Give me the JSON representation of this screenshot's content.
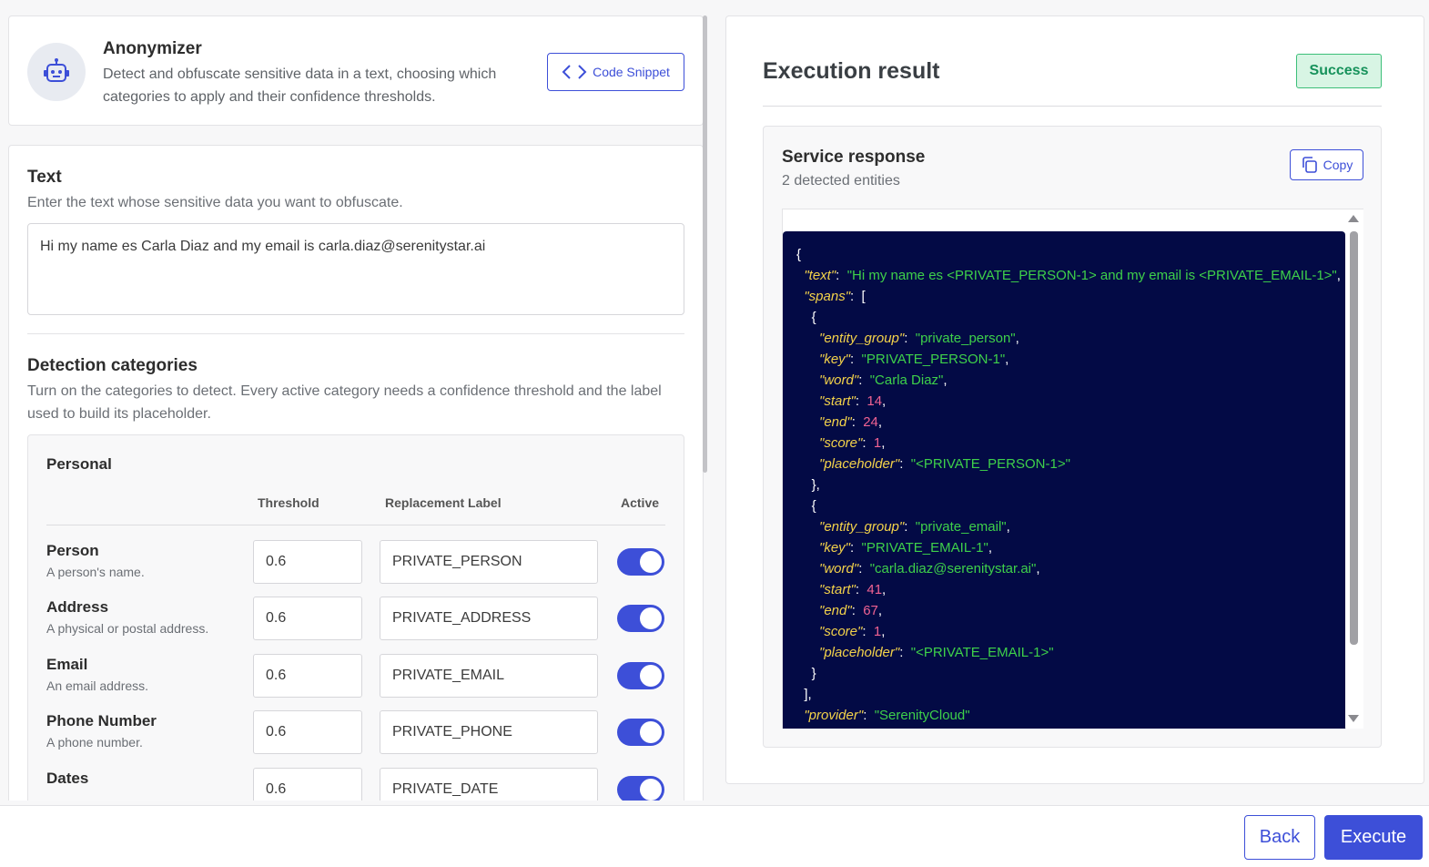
{
  "header": {
    "title": "Anonymizer",
    "description": "Detect and obfuscate sensitive data in a text, choosing which categories to apply and their confidence thresholds.",
    "code_snippet_label": "Code Snippet",
    "avatar_icon": "robot-icon"
  },
  "text_section": {
    "title": "Text",
    "description": "Enter the text whose sensitive data you want to obfuscate.",
    "value": "Hi my name es Carla Diaz and my email is carla.diaz@serenitystar.ai"
  },
  "detection": {
    "title": "Detection categories",
    "description": "Turn on the categories to detect. Every active category needs a confidence threshold and the label used to build its placeholder.",
    "group": "Personal",
    "columns": {
      "threshold": "Threshold",
      "label": "Replacement Label",
      "active": "Active"
    },
    "rows": [
      {
        "name": "Person",
        "desc": "A person's name.",
        "threshold": "0.6",
        "label": "PRIVATE_PERSON",
        "active": true
      },
      {
        "name": "Address",
        "desc": "A physical or postal address.",
        "threshold": "0.6",
        "label": "PRIVATE_ADDRESS",
        "active": true
      },
      {
        "name": "Email",
        "desc": "An email address.",
        "threshold": "0.6",
        "label": "PRIVATE_EMAIL",
        "active": true
      },
      {
        "name": "Phone Number",
        "desc": "A phone number.",
        "threshold": "0.6",
        "label": "PRIVATE_PHONE",
        "active": true
      },
      {
        "name": "Dates",
        "desc": "",
        "threshold": "0.6",
        "label": "PRIVATE_DATE",
        "active": true
      }
    ]
  },
  "result": {
    "title": "Execution result",
    "status": "Success",
    "response_title": "Service response",
    "response_subtitle": "2 detected entities",
    "copy_label": "Copy",
    "json_lines": [
      [
        [
          "p",
          "{"
        ]
      ],
      [
        [
          "p",
          "  "
        ],
        [
          "k",
          "\"text\""
        ],
        [
          "p",
          ":  "
        ],
        [
          "s",
          "\"Hi my name es <PRIVATE_PERSON-1> and my email is <PRIVATE_EMAIL-1>\""
        ],
        [
          "p",
          ","
        ]
      ],
      [
        [
          "p",
          "  "
        ],
        [
          "k",
          "\"spans\""
        ],
        [
          "p",
          ":  ["
        ]
      ],
      [
        [
          "p",
          "    {"
        ]
      ],
      [
        [
          "p",
          "      "
        ],
        [
          "k",
          "\"entity_group\""
        ],
        [
          "p",
          ":  "
        ],
        [
          "s",
          "\"private_person\""
        ],
        [
          "p",
          ","
        ]
      ],
      [
        [
          "p",
          "      "
        ],
        [
          "k",
          "\"key\""
        ],
        [
          "p",
          ":  "
        ],
        [
          "s",
          "\"PRIVATE_PERSON-1\""
        ],
        [
          "p",
          ","
        ]
      ],
      [
        [
          "p",
          "      "
        ],
        [
          "k",
          "\"word\""
        ],
        [
          "p",
          ":  "
        ],
        [
          "s",
          "\"Carla Diaz\""
        ],
        [
          "p",
          ","
        ]
      ],
      [
        [
          "p",
          "      "
        ],
        [
          "k",
          "\"start\""
        ],
        [
          "p",
          ":  "
        ],
        [
          "n",
          "14"
        ],
        [
          "p",
          ","
        ]
      ],
      [
        [
          "p",
          "      "
        ],
        [
          "k",
          "\"end\""
        ],
        [
          "p",
          ":  "
        ],
        [
          "n",
          "24"
        ],
        [
          "p",
          ","
        ]
      ],
      [
        [
          "p",
          "      "
        ],
        [
          "k",
          "\"score\""
        ],
        [
          "p",
          ":  "
        ],
        [
          "n",
          "1"
        ],
        [
          "p",
          ","
        ]
      ],
      [
        [
          "p",
          "      "
        ],
        [
          "k",
          "\"placeholder\""
        ],
        [
          "p",
          ":  "
        ],
        [
          "s",
          "\"<PRIVATE_PERSON-1>\""
        ]
      ],
      [
        [
          "p",
          "    },"
        ]
      ],
      [
        [
          "p",
          "    {"
        ]
      ],
      [
        [
          "p",
          "      "
        ],
        [
          "k",
          "\"entity_group\""
        ],
        [
          "p",
          ":  "
        ],
        [
          "s",
          "\"private_email\""
        ],
        [
          "p",
          ","
        ]
      ],
      [
        [
          "p",
          "      "
        ],
        [
          "k",
          "\"key\""
        ],
        [
          "p",
          ":  "
        ],
        [
          "s",
          "\"PRIVATE_EMAIL-1\""
        ],
        [
          "p",
          ","
        ]
      ],
      [
        [
          "p",
          "      "
        ],
        [
          "k",
          "\"word\""
        ],
        [
          "p",
          ":  "
        ],
        [
          "s",
          "\"carla.diaz@serenitystar.ai\""
        ],
        [
          "p",
          ","
        ]
      ],
      [
        [
          "p",
          "      "
        ],
        [
          "k",
          "\"start\""
        ],
        [
          "p",
          ":  "
        ],
        [
          "n",
          "41"
        ],
        [
          "p",
          ","
        ]
      ],
      [
        [
          "p",
          "      "
        ],
        [
          "k",
          "\"end\""
        ],
        [
          "p",
          ":  "
        ],
        [
          "n",
          "67"
        ],
        [
          "p",
          ","
        ]
      ],
      [
        [
          "p",
          "      "
        ],
        [
          "k",
          "\"score\""
        ],
        [
          "p",
          ":  "
        ],
        [
          "n",
          "1"
        ],
        [
          "p",
          ","
        ]
      ],
      [
        [
          "p",
          "      "
        ],
        [
          "k",
          "\"placeholder\""
        ],
        [
          "p",
          ":  "
        ],
        [
          "s",
          "\"<PRIVATE_EMAIL-1>\""
        ]
      ],
      [
        [
          "p",
          "    }"
        ]
      ],
      [
        [
          "p",
          "  ],"
        ]
      ],
      [
        [
          "p",
          "  "
        ],
        [
          "k",
          "\"provider\""
        ],
        [
          "p",
          ":  "
        ],
        [
          "s",
          "\"SerenityCloud\""
        ]
      ]
    ]
  },
  "footer": {
    "back_label": "Back",
    "execute_label": "Execute"
  },
  "colors": {
    "accent": "#3d4fd8",
    "success": "#17925b",
    "code_bg": "#030a45"
  }
}
